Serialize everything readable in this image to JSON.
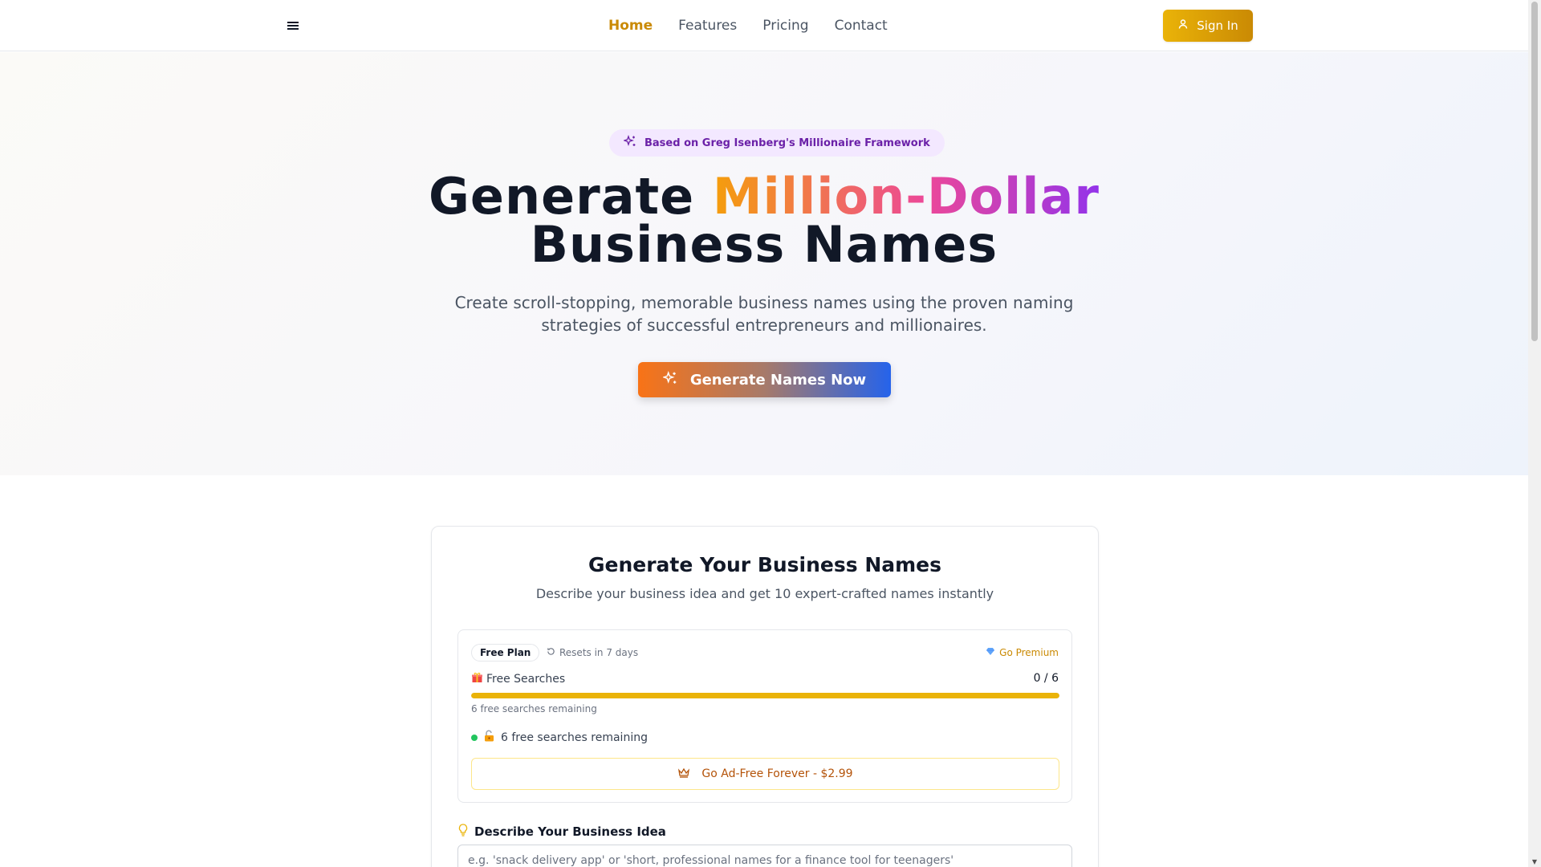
{
  "nav": {
    "links": [
      {
        "label": "Home",
        "active": true
      },
      {
        "label": "Features",
        "active": false
      },
      {
        "label": "Pricing",
        "active": false
      },
      {
        "label": "Contact",
        "active": false
      }
    ],
    "signin_label": "Sign In"
  },
  "hero": {
    "badge": "Based on Greg Isenberg's Millionaire Framework",
    "title_part1": "Generate ",
    "title_highlight": "Million-Dollar",
    "title_part2": "Business Names",
    "subtitle": "Create scroll-stopping, memorable business names using the proven naming strategies of successful entrepreneurs and millionaires.",
    "cta_label": "Generate Names Now"
  },
  "generator": {
    "title": "Generate Your Business Names",
    "subtitle": "Describe your business idea and get 10 expert-crafted names instantly",
    "plan": {
      "badge": "Free Plan",
      "resets": "Resets in 7 days",
      "premium_link": "Go Premium",
      "free_searches_label": "Free Searches",
      "count": "0 / 6",
      "progress_fraction": 1.0,
      "remaining_small": "6 free searches remaining",
      "status": "6 free searches remaining",
      "adfree_label": "Go Ad-Free Forever - $2.99"
    },
    "idea": {
      "label": "Describe Your Business Idea",
      "placeholder": "e.g. 'snack delivery app' or 'short, professional names for a finance tool for teenagers'"
    }
  },
  "colors": {
    "accent": "#ca8a04",
    "badge_bg": "#f3e8ff",
    "badge_text": "#6b21a8",
    "status_dot": "#22c55e"
  },
  "icons": [
    "menu-icon",
    "user-icon",
    "sparkles-icon",
    "refresh-icon",
    "gem-icon",
    "gift-icon",
    "unlock-icon",
    "crown-icon",
    "lightbulb-icon"
  ]
}
